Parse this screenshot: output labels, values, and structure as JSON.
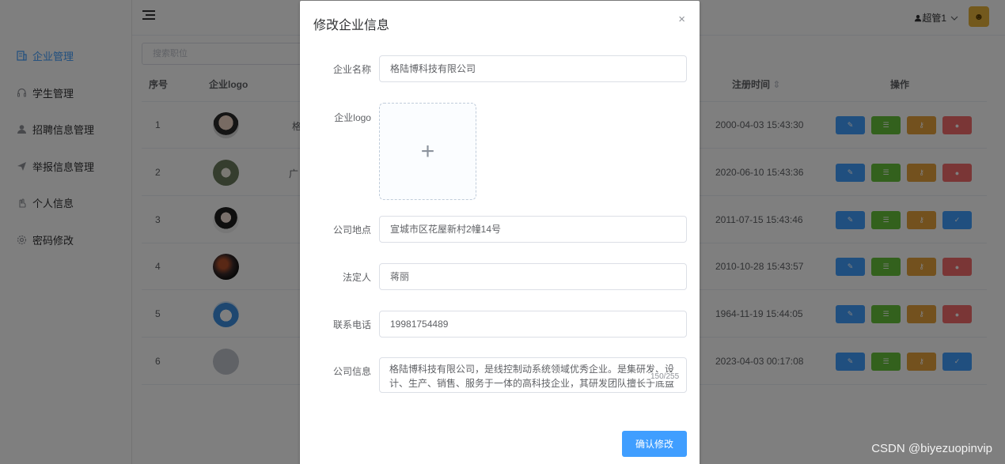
{
  "sidebar": {
    "items": [
      {
        "label": "企业管理",
        "icon": "building-icon",
        "active": true
      },
      {
        "label": "学生管理",
        "icon": "headset-icon",
        "active": false
      },
      {
        "label": "招聘信息管理",
        "icon": "user-icon",
        "active": false
      },
      {
        "label": "举报信息管理",
        "icon": "send-icon",
        "active": false
      },
      {
        "label": "个人信息",
        "icon": "hand-icon",
        "active": false
      },
      {
        "label": "密码修改",
        "icon": "gear-icon",
        "active": false
      }
    ]
  },
  "header": {
    "user_name": "超管1",
    "user_icon": "user-icon",
    "dropdown_icon": "chevron-down-icon"
  },
  "main": {
    "search_placeholder": "搜索职位",
    "table": {
      "headers": {
        "index": "序号",
        "logo": "企业logo",
        "reg_time": "注册时间",
        "sort_icon": "⇕",
        "ops": "操作"
      },
      "rows": [
        {
          "index": "1",
          "partial_name": "格",
          "reg_time": "2000-04-03 15:43:30",
          "last_op": "red"
        },
        {
          "index": "2",
          "partial_name": "广",
          "reg_time": "2020-06-10 15:43:36",
          "last_op": "red"
        },
        {
          "index": "3",
          "partial_name": "",
          "reg_time": "2011-07-15 15:43:46",
          "last_op": "blue"
        },
        {
          "index": "4",
          "partial_name": "",
          "reg_time": "2010-10-28 15:43:57",
          "last_op": "red"
        },
        {
          "index": "5",
          "partial_name": "",
          "reg_time": "1964-11-19 15:44:05",
          "last_op": "red"
        },
        {
          "index": "6",
          "partial_name": "",
          "reg_time": "2023-04-03 00:17:08",
          "last_op": "blue"
        }
      ]
    }
  },
  "dialog": {
    "title": "修改企业信息",
    "close_icon": "×",
    "fields": {
      "name_label": "企业名称",
      "name_value": "格陆博科技有限公司",
      "logo_label": "企业logo",
      "upload_icon": "+",
      "address_label": "公司地点",
      "address_value": "宣城市区花屋新村2幢14号",
      "legal_label": "法定人",
      "legal_value": "蒋丽",
      "phone_label": "联系电话",
      "phone_value": "19981754489",
      "info_label": "公司信息",
      "info_value": "格陆博科技有限公司，是线控制动系统领域优秀企业。是集研发、设计、生产、销售、服务于一体的高科技企业，其研发团队擅长于底盘线控...",
      "info_count": "150/255"
    },
    "confirm_label": "确认修改"
  },
  "watermark": "CSDN @biyezuopinvip",
  "colors": {
    "primary": "#409eff",
    "success": "#67c23a",
    "warning": "#e6a23c",
    "danger": "#f56c6c"
  }
}
